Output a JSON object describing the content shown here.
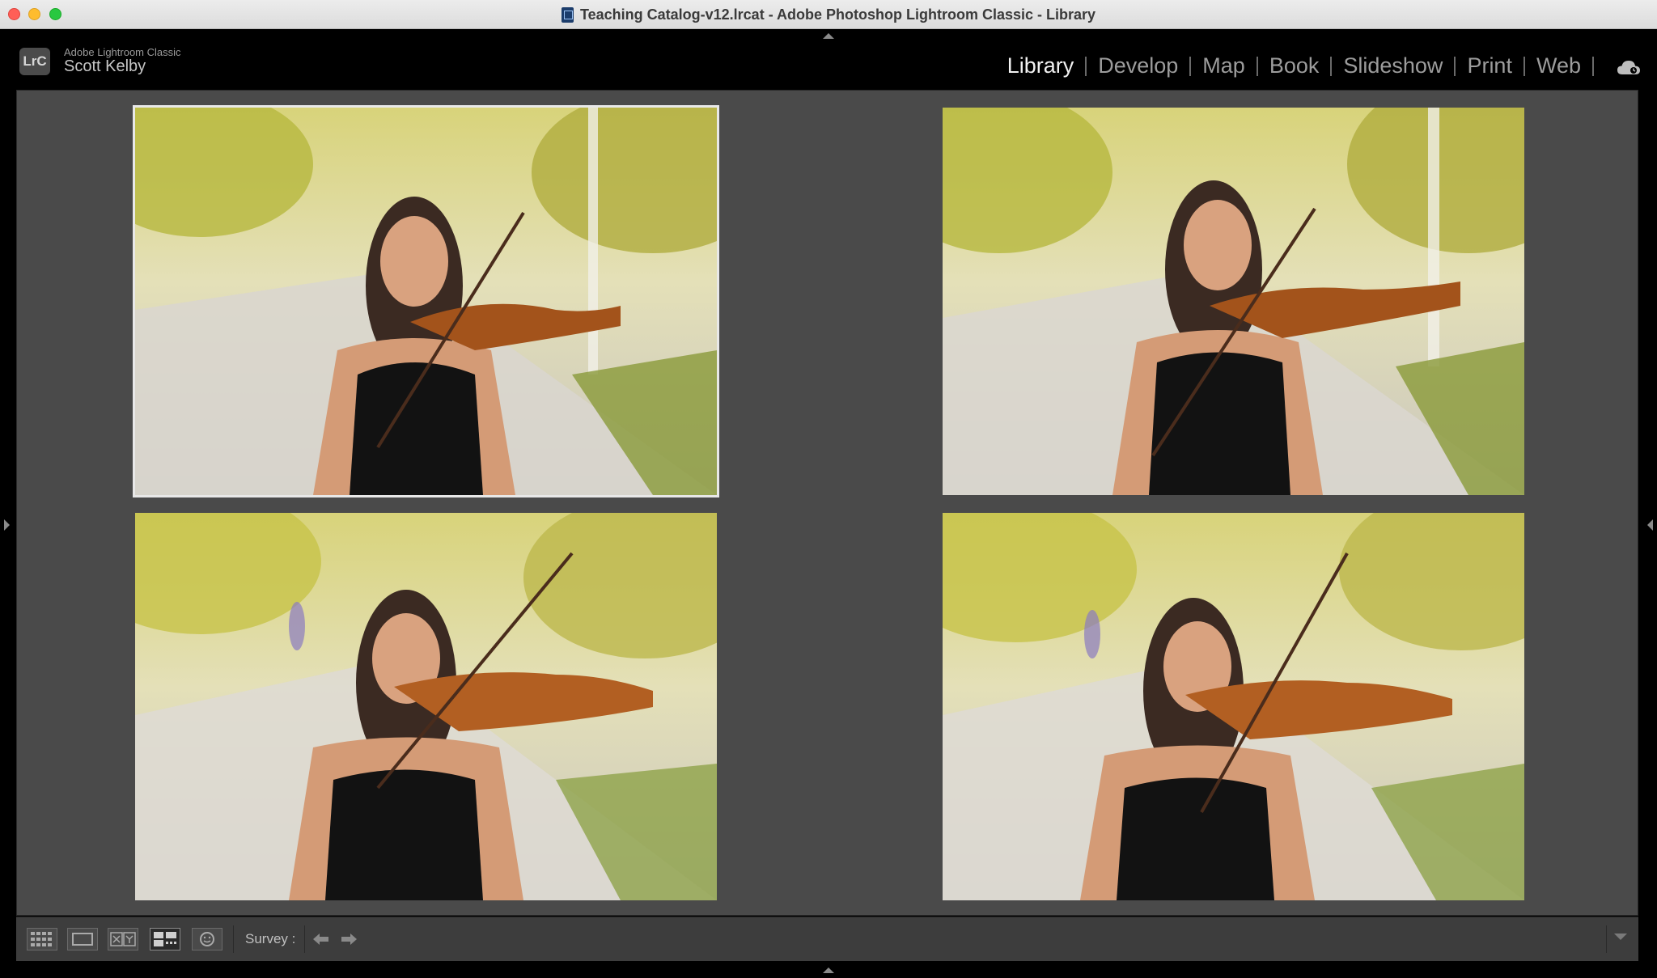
{
  "window": {
    "title": "Teaching Catalog-v12.lrcat - Adobe Photoshop Lightroom Classic - Library"
  },
  "identity": {
    "app_name": "Adobe Lightroom Classic",
    "badge": "LrC",
    "user": "Scott Kelby"
  },
  "modules": [
    {
      "label": "Library",
      "active": true
    },
    {
      "label": "Develop",
      "active": false
    },
    {
      "label": "Map",
      "active": false
    },
    {
      "label": "Book",
      "active": false
    },
    {
      "label": "Slideshow",
      "active": false
    },
    {
      "label": "Print",
      "active": false
    },
    {
      "label": "Web",
      "active": false
    }
  ],
  "survey": {
    "photos": [
      {
        "selected": true
      },
      {
        "selected": false
      },
      {
        "selected": false
      },
      {
        "selected": false
      }
    ]
  },
  "toolbar": {
    "survey_label": "Survey :",
    "view_icons": [
      "grid-view-icon",
      "loupe-view-icon",
      "compare-view-icon",
      "survey-view-icon",
      "people-view-icon"
    ]
  },
  "colors": {
    "background": "#4a4a4a",
    "active_module": "#f2f2f2",
    "inactive_module": "#9c9c9c"
  }
}
